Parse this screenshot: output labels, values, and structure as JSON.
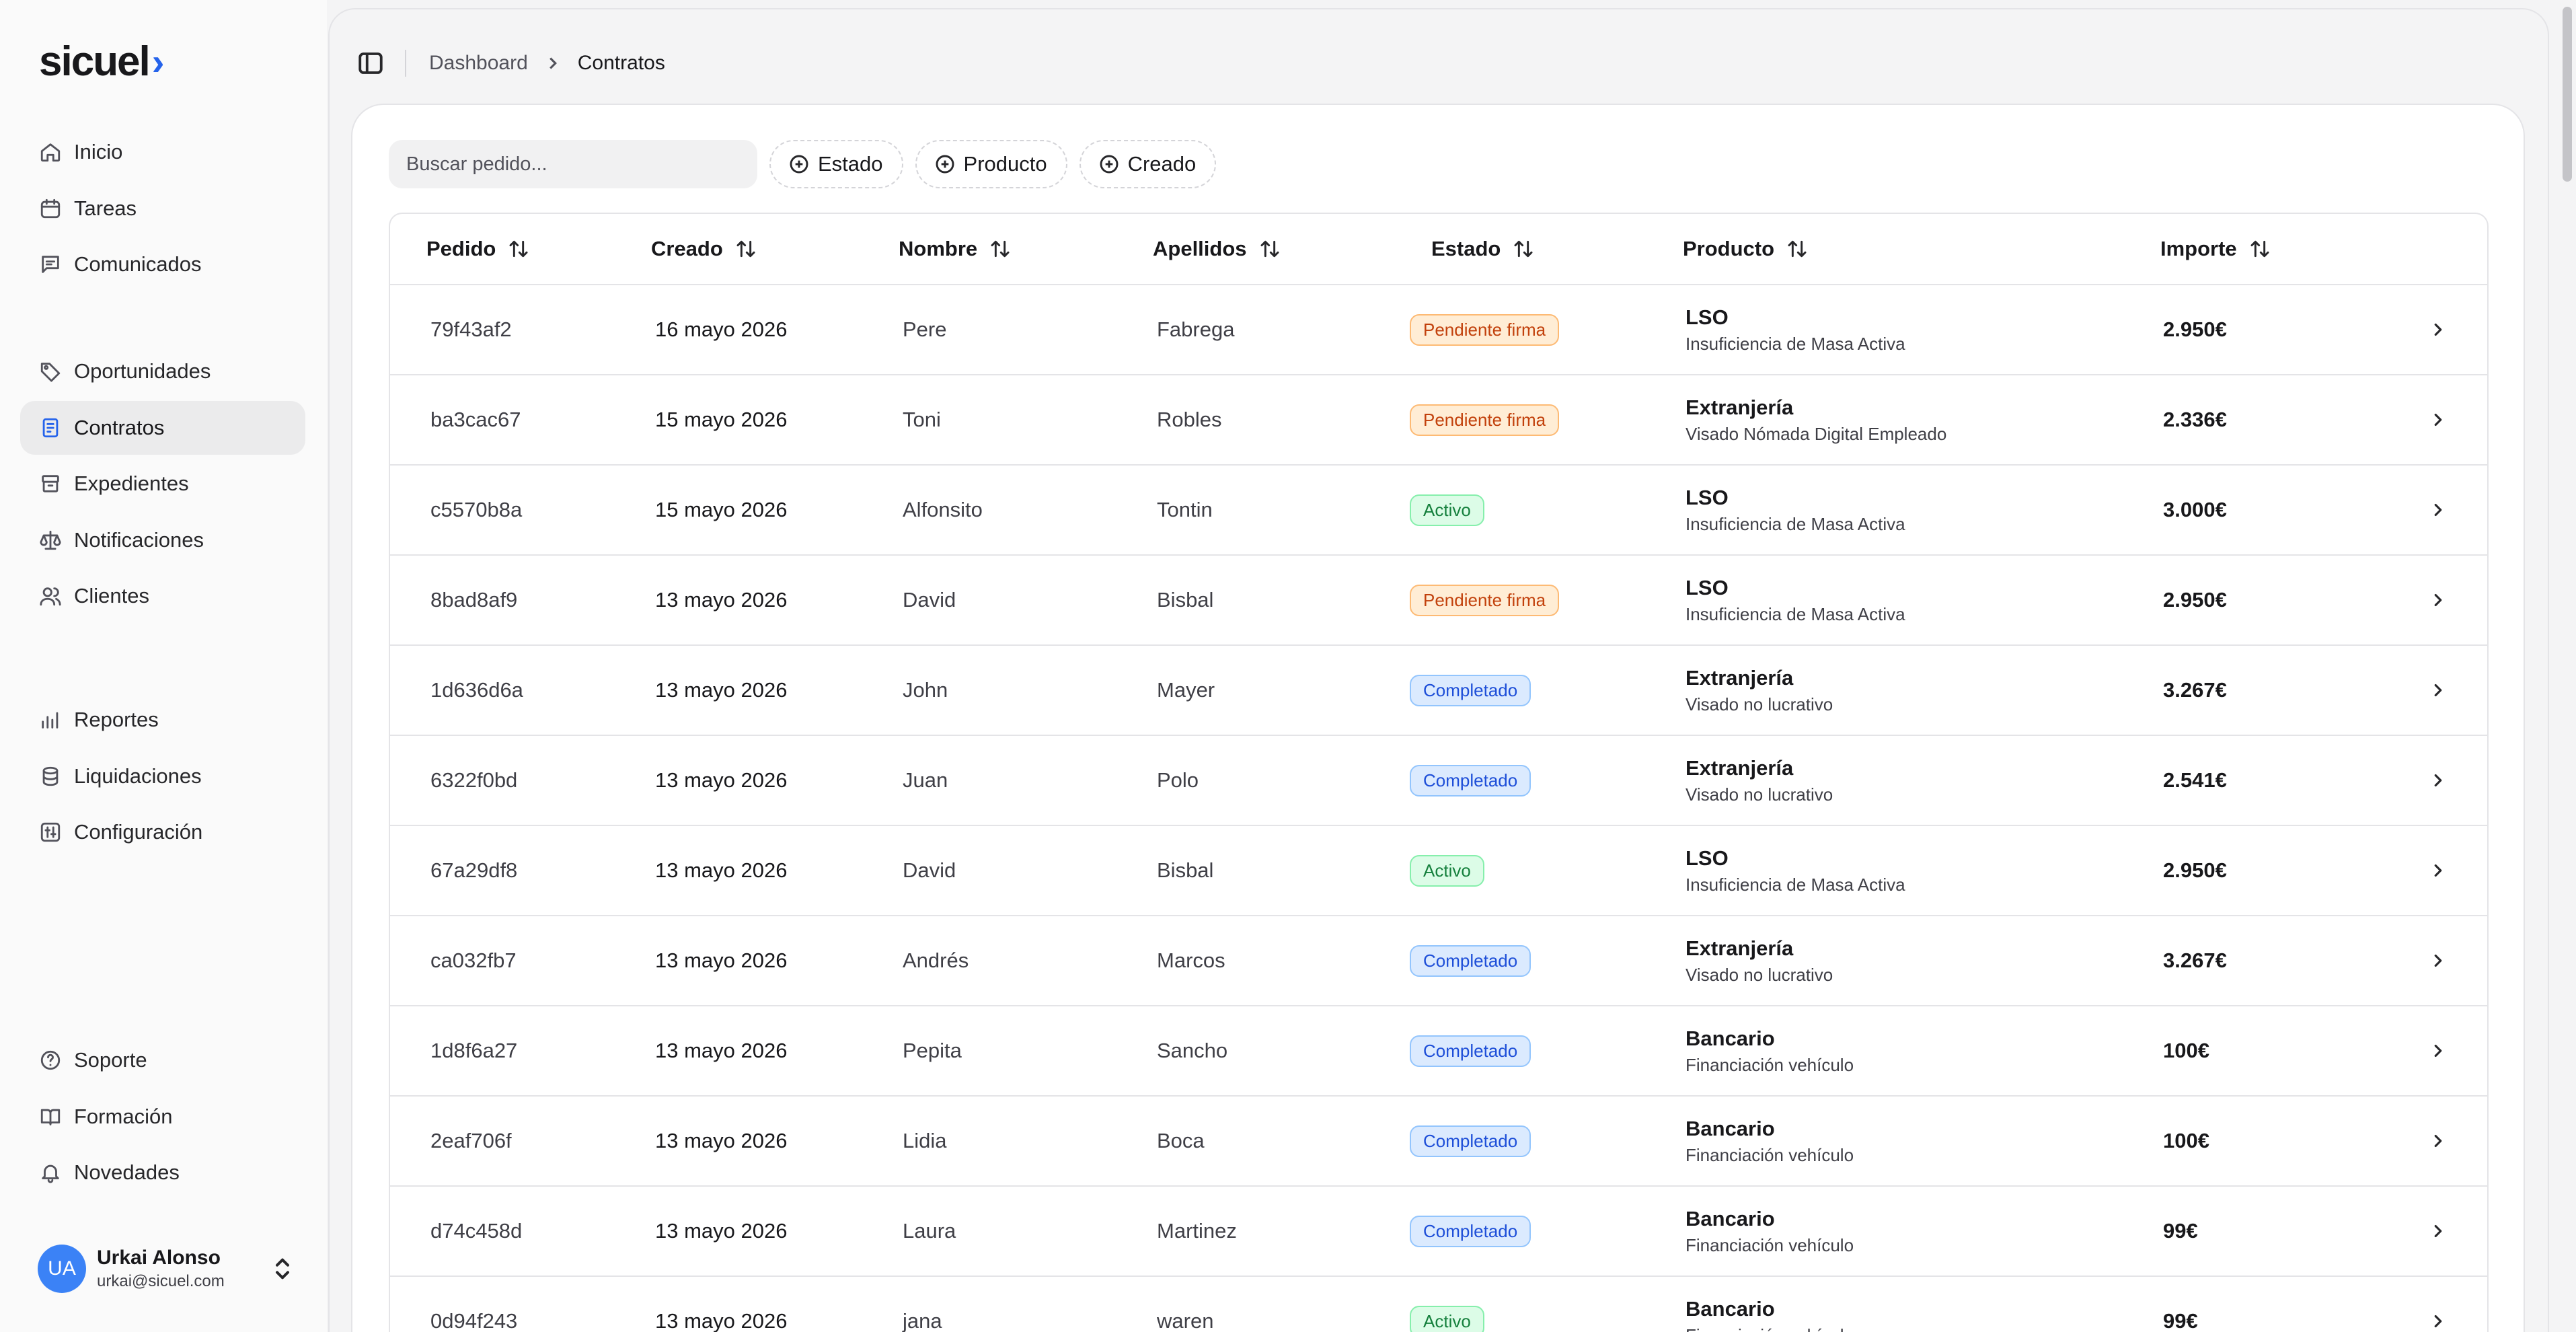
{
  "brand": {
    "name": "sicuel",
    "chevron": "›"
  },
  "sidebar": {
    "groups": [
      [
        {
          "label": "Inicio",
          "icon": "home-icon"
        },
        {
          "label": "Tareas",
          "icon": "calendar-icon"
        },
        {
          "label": "Comunicados",
          "icon": "message-icon"
        }
      ],
      [
        {
          "label": "Oportunidades",
          "icon": "tag-icon"
        },
        {
          "label": "Contratos",
          "icon": "contract-icon",
          "active": true
        },
        {
          "label": "Expedientes",
          "icon": "archive-icon"
        },
        {
          "label": "Notificaciones",
          "icon": "scale-icon"
        },
        {
          "label": "Clientes",
          "icon": "users-icon"
        }
      ],
      [
        {
          "label": "Reportes",
          "icon": "chart-icon"
        },
        {
          "label": "Liquidaciones",
          "icon": "coins-icon"
        },
        {
          "label": "Configuración",
          "icon": "settings-icon"
        }
      ],
      [
        {
          "label": "Soporte",
          "icon": "help-icon"
        },
        {
          "label": "Formación",
          "icon": "book-icon"
        },
        {
          "label": "Novedades",
          "icon": "bell-icon"
        }
      ]
    ]
  },
  "user": {
    "initials": "UA",
    "name": "Urkai Alonso",
    "email": "urkai@sicuel.com"
  },
  "breadcrumb": {
    "parent": "Dashboard",
    "current": "Contratos"
  },
  "toolbar": {
    "search_placeholder": "Buscar pedido...",
    "filters": [
      "Estado",
      "Producto",
      "Creado"
    ]
  },
  "table": {
    "columns": [
      "Pedido",
      "Creado",
      "Nombre",
      "Apellidos",
      "Estado",
      "Producto",
      "Importe"
    ],
    "rows": [
      {
        "id": "79f43af2",
        "created": "16 mayo 2026",
        "name": "Pere",
        "last": "Fabrega",
        "status": "Pendiente firma",
        "kind": "pending",
        "product": "LSO",
        "sub": "Insuficiencia de Masa Activa",
        "amount": "2.950€"
      },
      {
        "id": "ba3cac67",
        "created": "15 mayo 2026",
        "name": "Toni",
        "last": "Robles",
        "status": "Pendiente firma",
        "kind": "pending",
        "product": "Extranjería",
        "sub": "Visado Nómada Digital Empleado",
        "amount": "2.336€"
      },
      {
        "id": "c5570b8a",
        "created": "15 mayo 2026",
        "name": "Alfonsito",
        "last": "Tontin",
        "status": "Activo",
        "kind": "active",
        "product": "LSO",
        "sub": "Insuficiencia de Masa Activa",
        "amount": "3.000€"
      },
      {
        "id": "8bad8af9",
        "created": "13 mayo 2026",
        "name": "David",
        "last": "Bisbal",
        "status": "Pendiente firma",
        "kind": "pending",
        "product": "LSO",
        "sub": "Insuficiencia de Masa Activa",
        "amount": "2.950€"
      },
      {
        "id": "1d636d6a",
        "created": "13 mayo 2026",
        "name": "John",
        "last": "Mayer",
        "status": "Completado",
        "kind": "done",
        "product": "Extranjería",
        "sub": "Visado no lucrativo",
        "amount": "3.267€"
      },
      {
        "id": "6322f0bd",
        "created": "13 mayo 2026",
        "name": "Juan",
        "last": "Polo",
        "status": "Completado",
        "kind": "done",
        "product": "Extranjería",
        "sub": "Visado no lucrativo",
        "amount": "2.541€"
      },
      {
        "id": "67a29df8",
        "created": "13 mayo 2026",
        "name": "David",
        "last": "Bisbal",
        "status": "Activo",
        "kind": "active",
        "product": "LSO",
        "sub": "Insuficiencia de Masa Activa",
        "amount": "2.950€"
      },
      {
        "id": "ca032fb7",
        "created": "13 mayo 2026",
        "name": "Andrés",
        "last": "Marcos",
        "status": "Completado",
        "kind": "done",
        "product": "Extranjería",
        "sub": "Visado no lucrativo",
        "amount": "3.267€"
      },
      {
        "id": "1d8f6a27",
        "created": "13 mayo 2026",
        "name": "Pepita",
        "last": "Sancho",
        "status": "Completado",
        "kind": "done",
        "product": "Bancario",
        "sub": "Financiación vehículo",
        "amount": "100€"
      },
      {
        "id": "2eaf706f",
        "created": "13 mayo 2026",
        "name": "Lidia",
        "last": "Boca",
        "status": "Completado",
        "kind": "done",
        "product": "Bancario",
        "sub": "Financiación vehículo",
        "amount": "100€"
      },
      {
        "id": "d74c458d",
        "created": "13 mayo 2026",
        "name": "Laura",
        "last": "Martinez",
        "status": "Completado",
        "kind": "done",
        "product": "Bancario",
        "sub": "Financiación vehículo",
        "amount": "99€"
      },
      {
        "id": "0d94f243",
        "created": "13 mayo 2026",
        "name": "jana",
        "last": "waren",
        "status": "Activo",
        "kind": "active",
        "product": "Bancario",
        "sub": "Financiación vehículo",
        "amount": "99€"
      }
    ]
  }
}
